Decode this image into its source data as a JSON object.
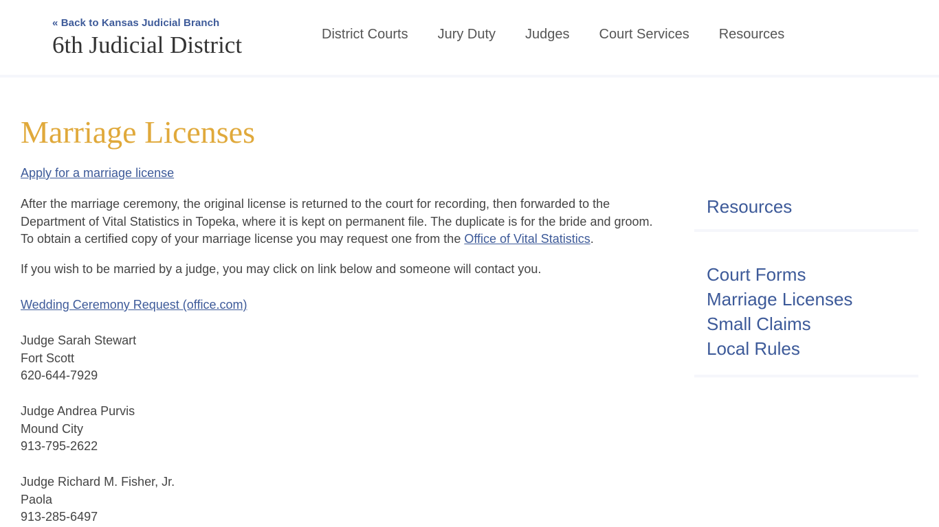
{
  "header": {
    "back_link": "« Back to Kansas Judicial Branch",
    "site_title": "6th Judicial District",
    "nav": [
      "District Courts",
      "Jury Duty",
      "Judges",
      "Court Services",
      "Resources"
    ]
  },
  "main": {
    "title": "Marriage Licenses",
    "apply_link": "Apply for a marriage license",
    "body_text": "After the marriage ceremony, the original license is returned to the court for recording, then forwarded to the Department of Vital Statistics in Topeka, where it is kept on permanent file. The duplicate is for the bride and groom. To obtain a certified copy of your marriage license you may request one from the ",
    "vital_link": "Office of Vital Statistics",
    "body_end": ".",
    "judge_intro": "If you wish to be married by a judge, you may click on link below and someone will contact you.",
    "wedding_link": "Wedding Ceremony Request  (office.com)",
    "judges": [
      {
        "name": "Judge Sarah Stewart",
        "city": "Fort Scott",
        "phone": "620-644-7929"
      },
      {
        "name": "Judge Andrea Purvis",
        "city": "Mound City",
        "phone": "913-795-2622"
      },
      {
        "name": "Judge Richard M. Fisher, Jr.",
        "city": "Paola",
        "phone": "913-285-6497"
      }
    ]
  },
  "sidebar": {
    "heading": "Resources",
    "links": [
      "Court Forms",
      "Marriage Licenses",
      "Small Claims",
      "Local Rules"
    ]
  }
}
